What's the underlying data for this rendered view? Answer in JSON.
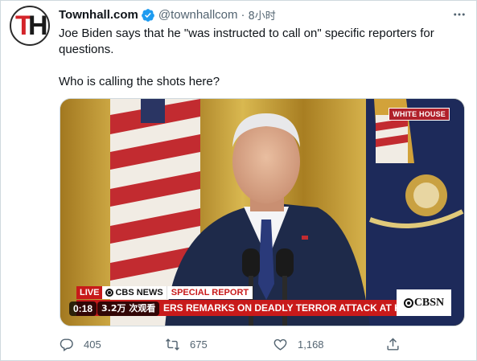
{
  "author": {
    "display_name": "Townhall.com",
    "handle": "@townhallcom",
    "separator": "·",
    "time": "8小时",
    "avatar_initial_1": "T",
    "avatar_initial_2": "H"
  },
  "tweet": {
    "line1": "Joe Biden says that he \"was instructed to call on\" specific reporters for questions.",
    "line2": "Who is calling the shots here?"
  },
  "video": {
    "badge": "WHITE HOUSE",
    "live_label": "LIVE",
    "network_label": "CBS NEWS",
    "special_label": "SPECIAL REPORT",
    "ticker": "ERS REMARKS ON DEADLY TERROR ATTACK AT KABUL AIRPORT",
    "logo": "CBSN",
    "duration": "0:18",
    "views": "3.2万 次观看"
  },
  "actions": {
    "reply_count": "405",
    "retweet_count": "675",
    "like_count": "1,168"
  },
  "icons": [
    "verified-badge-icon",
    "more-icon",
    "reply-icon",
    "retweet-icon",
    "like-icon",
    "share-icon"
  ],
  "colors": {
    "verified": "#1d9bf0",
    "meta": "#536471",
    "cbs_red": "#c81a1a"
  }
}
